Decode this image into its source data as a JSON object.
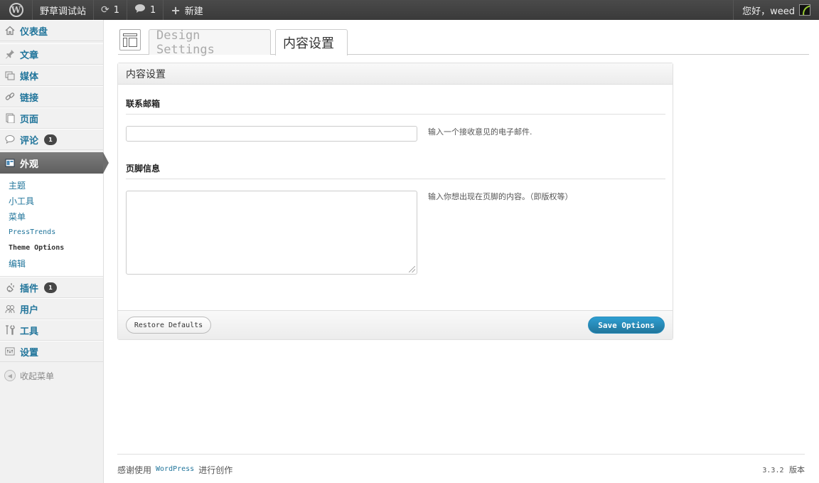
{
  "adminbar": {
    "site_name": "野草调试站",
    "updates_count": "1",
    "comments_count": "1",
    "new_label": "新建",
    "greeting": "您好，weed"
  },
  "sidebar": {
    "items": [
      {
        "label": "仪表盘",
        "icon": "home-icon"
      },
      {
        "label": "文章",
        "icon": "pin-icon"
      },
      {
        "label": "媒体",
        "icon": "media-icon"
      },
      {
        "label": "链接",
        "icon": "link-icon"
      },
      {
        "label": "页面",
        "icon": "page-icon"
      },
      {
        "label": "评论",
        "icon": "comment-icon",
        "badge": "1"
      },
      {
        "label": "外观",
        "icon": "appearance-icon"
      },
      {
        "label": "插件",
        "icon": "plugin-icon",
        "badge": "1"
      },
      {
        "label": "用户",
        "icon": "users-icon"
      },
      {
        "label": "工具",
        "icon": "tools-icon"
      },
      {
        "label": "设置",
        "icon": "settings-icon"
      }
    ],
    "submenu": [
      "主题",
      "小工具",
      "菜单",
      "PressTrends",
      "Theme Options",
      "编辑"
    ],
    "collapse_label": "收起菜单"
  },
  "tabs": {
    "design": "Design Settings",
    "content": "内容设置"
  },
  "panel": {
    "title": "内容设置",
    "email_section": "联系邮箱",
    "email_value": "",
    "email_desc": "输入一个接收意见的电子邮件.",
    "footer_section": "页脚信息",
    "footer_value": "",
    "footer_desc": "输入你想出现在页脚的内容。（即版权等）",
    "restore_label": "Restore Defaults",
    "save_label": "Save Options"
  },
  "footer": {
    "thanks_prefix": "感谢使用",
    "wp_link": "WordPress",
    "thanks_suffix": "进行创作",
    "version_num": "3.3.2",
    "version_label": "版本"
  },
  "colors": {
    "link": "#21759b",
    "adminbar": "#464646",
    "primary_button": "#21759b"
  }
}
